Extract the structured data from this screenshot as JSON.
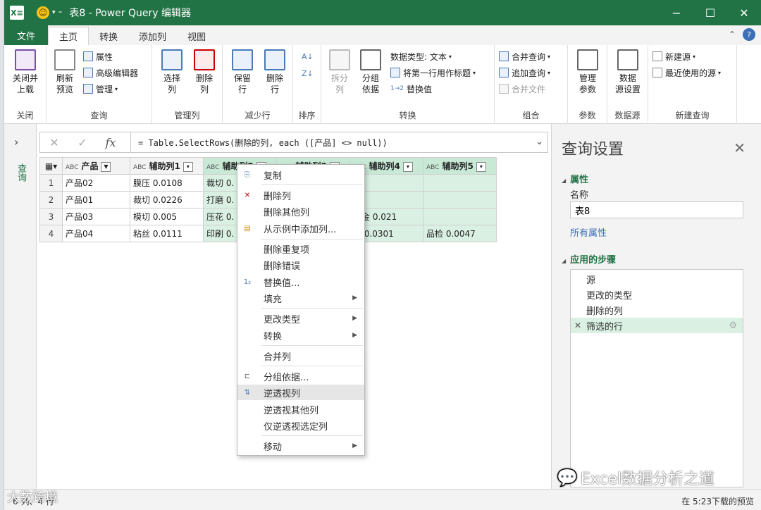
{
  "window": {
    "title": "表8 - Power Query 编辑器",
    "app_icon": "X≡",
    "controls": [
      "−",
      "☐",
      "✕"
    ]
  },
  "tabs": [
    {
      "label": "文件"
    },
    {
      "label": "主页"
    },
    {
      "label": "转换"
    },
    {
      "label": "添加列"
    },
    {
      "label": "视图"
    }
  ],
  "ribbon": {
    "close": {
      "btn": "关闭并\n上载",
      "label": "关闭"
    },
    "query": {
      "refresh": "刷新\n预览",
      "props": "属性",
      "adv": "高级编辑器",
      "manage": "管理",
      "label": "查询"
    },
    "manage_cols": {
      "choose": "选择\n列",
      "remove": "删除\n列",
      "label": "管理列"
    },
    "reduce_rows": {
      "keep": "保留\n行",
      "remove": "删除\n行",
      "label": "减少行"
    },
    "sort": {
      "label": "排序"
    },
    "transform": {
      "split": "拆分\n列",
      "group": "分组\n依据",
      "dtype": "数据类型: 文本",
      "first_row": "将第一行用作标题",
      "replace": "替换值",
      "label": "转换"
    },
    "combine": {
      "merge": "合并查询",
      "append": "追加查询",
      "files": "合并文件",
      "label": "组合"
    },
    "params": {
      "manage": "管理\n参数",
      "label": "参数"
    },
    "datasource": {
      "settings": "数据\n源设置",
      "label": "数据源"
    },
    "newquery": {
      "new": "新建源",
      "recent": "最近使用的源",
      "label": "新建查询"
    }
  },
  "nav": {
    "label": "查询"
  },
  "formula": "= Table.SelectRows(删除的列, each ([产品] <> null))",
  "grid": {
    "headers": [
      "产品",
      "辅助列1",
      "辅助列2",
      "辅助列3",
      "辅助列4",
      "辅助列5"
    ],
    "rows": [
      {
        "n": "1",
        "c": [
          "产品02",
          "膜压 0.0108",
          "裁切 0.",
          "",
          "",
          ""
        ]
      },
      {
        "n": "2",
        "c": [
          "产品01",
          "裁切 0.0226",
          "打磨 0.",
          "",
          "",
          ""
        ]
      },
      {
        "n": "3",
        "c": [
          "产品03",
          "模切 0.005",
          "压花 0.",
          "",
          "烫金 0.021",
          ""
        ]
      },
      {
        "n": "4",
        "c": [
          "产品04",
          "粘丝 0.0111",
          "印刷 0.",
          "",
          "包 0.0301",
          "品检 0.0047"
        ]
      }
    ]
  },
  "context_menu": [
    "复制",
    "删除列",
    "删除其他列",
    "从示例中添加列...",
    "删除重复项",
    "删除错误",
    "替换值...",
    "填充",
    "更改类型",
    "转换",
    "合并列",
    "分组依据...",
    "逆透视列",
    "逆透视其他列",
    "仅逆透视选定列",
    "移动"
  ],
  "settings": {
    "title": "查询设置",
    "props_section": "属性",
    "name_label": "名称",
    "name_value": "表8",
    "all_props": "所有属性",
    "steps_section": "应用的步骤",
    "steps": [
      "源",
      "更改的类型",
      "删除的列",
      "筛选的行"
    ]
  },
  "status": {
    "left": "6 列、4 行",
    "right": "在 5:23下载的预览"
  },
  "watermark": {
    "right": "Excel数据分析之道",
    "left": "大数跨境"
  },
  "colors": {
    "excel_green": "#217346",
    "highlight": "#d9f0e3"
  }
}
